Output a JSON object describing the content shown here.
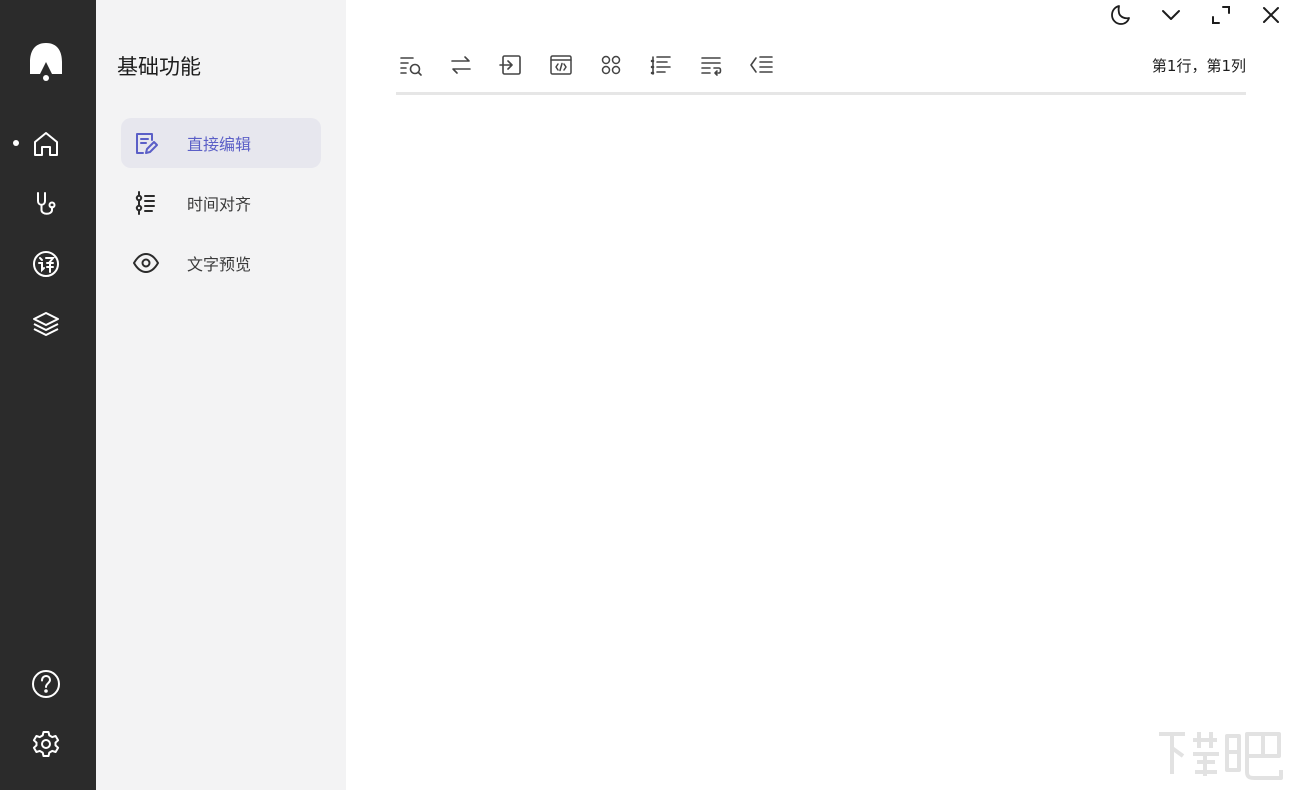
{
  "rail": {
    "items": [
      {
        "icon": "home-icon",
        "active": true
      },
      {
        "icon": "stethoscope-icon",
        "active": false
      },
      {
        "icon": "translate-icon",
        "active": false
      },
      {
        "icon": "layers-icon",
        "active": false
      }
    ],
    "bottom_items": [
      {
        "icon": "help-icon"
      },
      {
        "icon": "settings-icon"
      }
    ]
  },
  "panel": {
    "title": "基础功能",
    "items": [
      {
        "label": "直接编辑",
        "icon": "edit-document-icon",
        "active": true
      },
      {
        "label": "时间对齐",
        "icon": "timeline-align-icon",
        "active": false
      },
      {
        "label": "文字预览",
        "icon": "eye-icon",
        "active": false
      }
    ]
  },
  "window_controls": [
    "theme-moon-icon",
    "chevron-down-icon",
    "maximize-icon",
    "close-icon"
  ],
  "toolbar": {
    "tools": [
      "find-icon",
      "swap-icon",
      "import-icon",
      "code-icon",
      "grid-icon",
      "sort-icon",
      "wrap-icon",
      "outdent-icon"
    ]
  },
  "status": {
    "cursor_position": "第1行，第1列"
  },
  "colors": {
    "rail_bg": "#2b2b2b",
    "panel_bg": "#f3f3f4",
    "accent": "#5b5fc7"
  }
}
